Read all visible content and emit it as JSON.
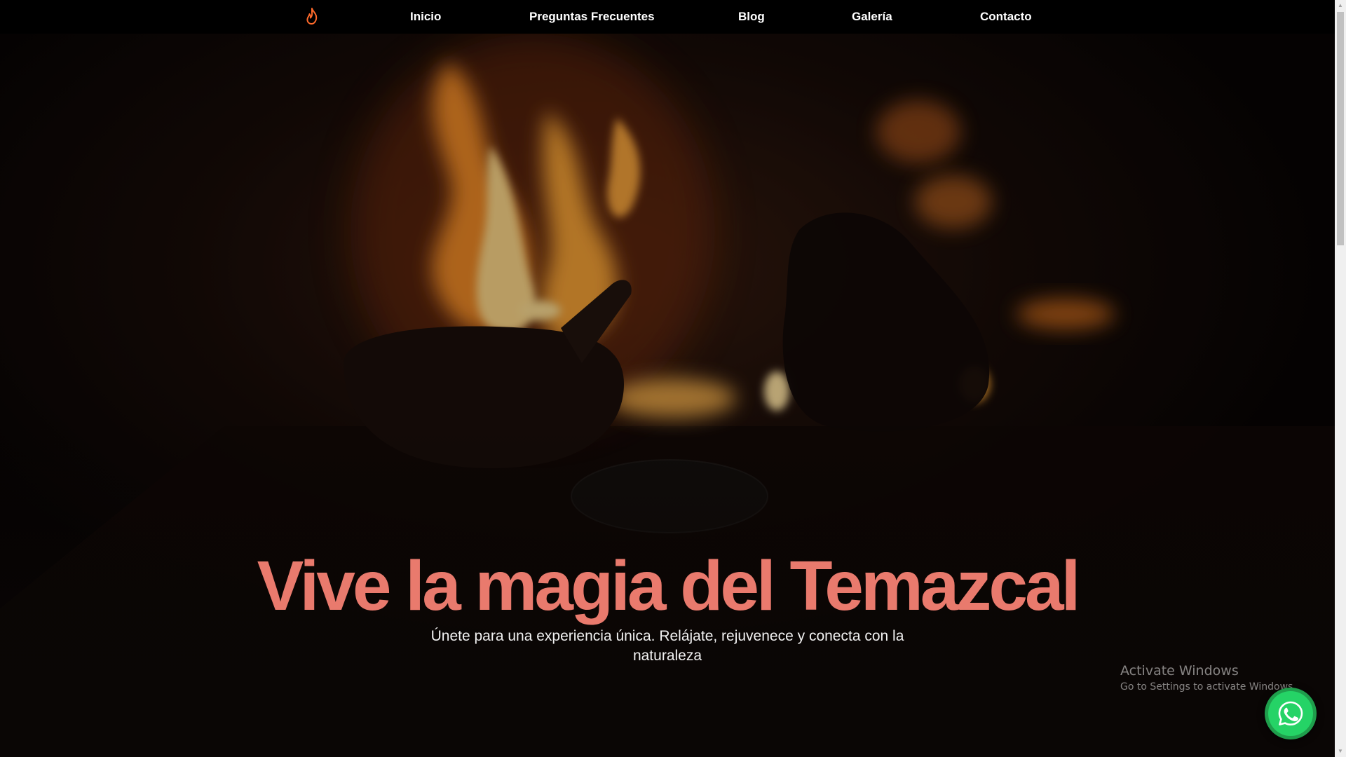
{
  "colors": {
    "accent": "#e97a6d",
    "logo": "#ff6a2b",
    "whatsapp": "#25d366",
    "navbar": "#000000"
  },
  "nav": {
    "logo_icon": "flame-icon",
    "links": [
      "Inicio",
      "Preguntas Frecuentes",
      "Blog",
      "Galería",
      "Contacto"
    ]
  },
  "hero": {
    "title": "Vive la magia del Temazcal",
    "subtitle": "Únete para una experiencia única. Relájate, rejuvenece y conecta con la naturaleza"
  },
  "watermark": {
    "title": "Activate Windows",
    "subtitle": "Go to Settings to activate Windows."
  },
  "whatsapp": {
    "icon": "whatsapp-icon"
  }
}
